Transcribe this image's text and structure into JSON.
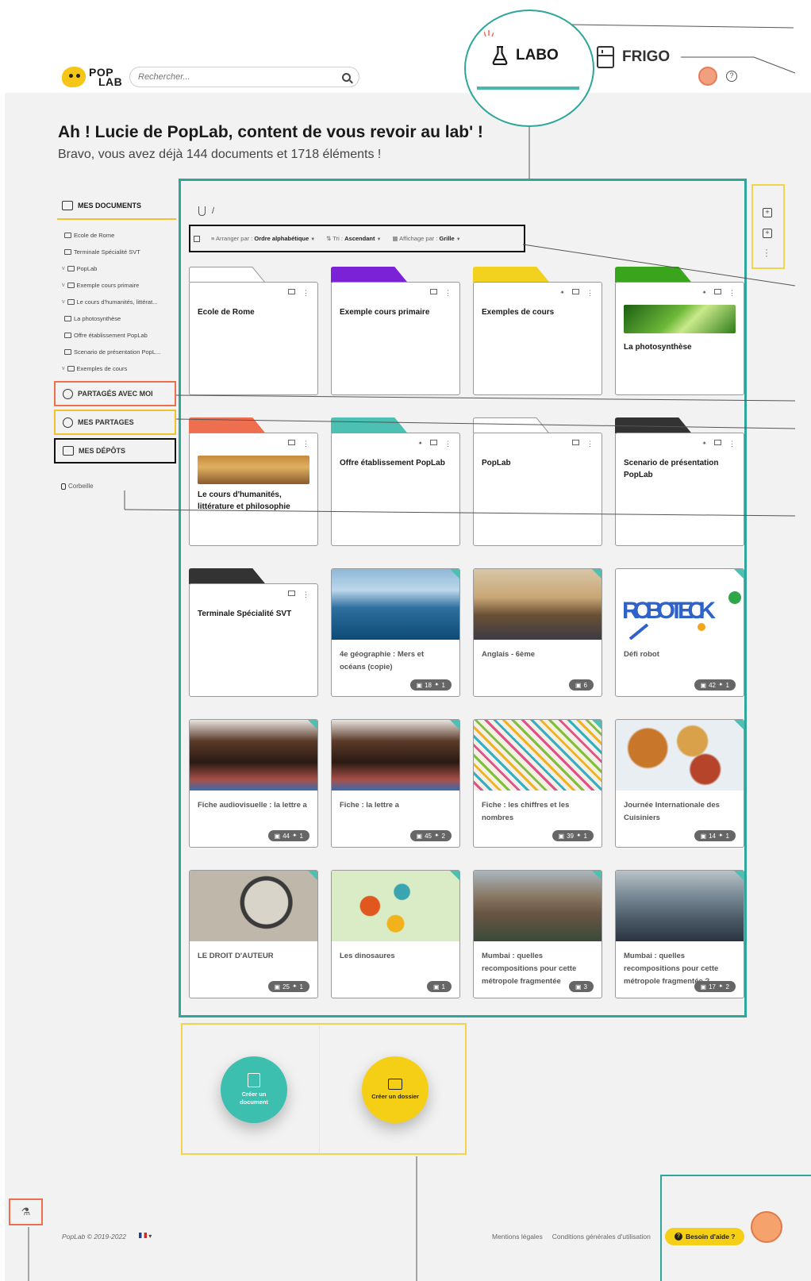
{
  "header": {
    "logo_line1": "POP",
    "logo_line2": "LAB",
    "search_placeholder": "Rechercher...",
    "tab_labo": "LABO",
    "tab_frigo": "FRIGO",
    "help_label": "?"
  },
  "greeting": {
    "title": "Ah ! Lucie de PopLab, content de vous revoir au lab' !",
    "subtitle": "Bravo, vous avez déjà 144 documents et 1718 éléments !"
  },
  "sidebar": {
    "mes_documents": "MES DOCUMENTS",
    "tree": [
      {
        "label": "Ecole de Rome",
        "chevron": ""
      },
      {
        "label": "Terminale Spécialité SVT",
        "chevron": ""
      },
      {
        "label": "PopLab",
        "chevron": "v"
      },
      {
        "label": "Exemple cours primaire",
        "chevron": "v"
      },
      {
        "label": "Le cours d'humanités, littérat...",
        "chevron": "v"
      },
      {
        "label": "La photosynthèse",
        "chevron": ""
      },
      {
        "label": "Offre établissement PopLab",
        "chevron": ""
      },
      {
        "label": "Scenario de présentation PopL...",
        "chevron": ""
      },
      {
        "label": "Exemples de cours",
        "chevron": "v"
      }
    ],
    "partages_avec_moi": "PARTAGÉS AVEC MOI",
    "mes_partages": "MES PARTAGES",
    "mes_depots": "MES DÉPÔTS",
    "corbeille": "Corbeille"
  },
  "main": {
    "breadcrumb": "/",
    "toolbar": {
      "arrange_label": "Arranger par :",
      "arrange_value": "Ordre alphabétique",
      "sort_label": "Tri :",
      "sort_value": "Ascendant",
      "display_label": "Affichage par :",
      "display_value": "Grille"
    },
    "folders": [
      {
        "title": "Ecole de Rome",
        "color": "#ffffff",
        "shared": false
      },
      {
        "title": "Exemple cours primaire",
        "color": "#7b22d6",
        "shared": false
      },
      {
        "title": "Exemples de cours",
        "color": "#f2d21f",
        "shared": true
      },
      {
        "title": "La photosynthèse",
        "color": "#3aa51c",
        "shared": true
      },
      {
        "title": "Le cours d'humanités, littérature et philosophie",
        "color": "#ee6e50",
        "shared": false
      },
      {
        "title": "Offre établissement PopLab",
        "color": "#4cc0b2",
        "shared": true
      },
      {
        "title": "PopLab",
        "color": "#ffffff",
        "shared": false
      },
      {
        "title": "Scenario de présentation PopLab",
        "color": "#333333",
        "shared": true
      },
      {
        "title": "Terminale Spécialité SVT",
        "color": "#333333",
        "shared": false
      }
    ],
    "documents": [
      {
        "title": "4e géographie : Mers et océans (copie)",
        "pages": "18",
        "users": "1"
      },
      {
        "title": "Anglais - 6ème",
        "pages": "6",
        "users": ""
      },
      {
        "title": "Défi robot",
        "pages": "42",
        "users": "1"
      },
      {
        "title": "Fiche audiovisuelle : la lettre a",
        "pages": "44",
        "users": "1"
      },
      {
        "title": "Fiche : la lettre a",
        "pages": "45",
        "users": "2"
      },
      {
        "title": "Fiche : les chiffres et les nombres",
        "pages": "39",
        "users": "1"
      },
      {
        "title": "Journée Internationale des Cuisiniers",
        "pages": "14",
        "users": "1"
      },
      {
        "title": "LE DROIT D'AUTEUR",
        "pages": "25",
        "users": "1"
      },
      {
        "title": "Les dinosaures",
        "pages": "1",
        "users": ""
      },
      {
        "title": "Mumbai : quelles recompositions pour cette métropole fragmentée",
        "pages": "3",
        "users": ""
      },
      {
        "title": "Mumbai : quelles recompositions pour cette métropole fragmentée ?",
        "pages": "17",
        "users": "2"
      }
    ]
  },
  "actions": {
    "create_document": "Créer un document",
    "create_folder": "Créer un dossier"
  },
  "footer": {
    "copyright": "PopLab © 2019-2022",
    "mentions": "Mentions légales",
    "cgu": "Conditions générales d'utilisation",
    "help": "Besoin d'aide ?"
  },
  "colors": {
    "accent_teal": "#2fa69a",
    "accent_yellow": "#f2d34c",
    "accent_coral": "#ee6e50"
  }
}
